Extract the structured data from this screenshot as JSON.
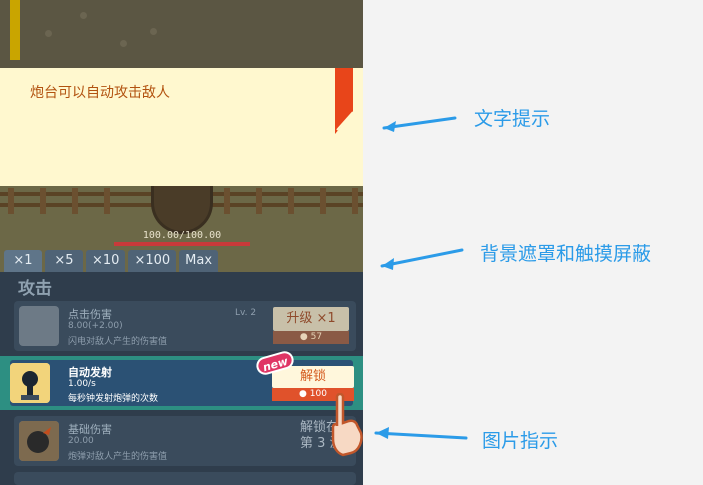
{
  "tip": {
    "text": "炮台可以自动攻击敌人"
  },
  "hp": {
    "text": "100.00/100.00",
    "fraction": 1.0
  },
  "multiplier_tabs": [
    "×1",
    "×5",
    "×10",
    "×100",
    "Max"
  ],
  "section_title": "攻击",
  "cards": [
    {
      "name": "点击伤害",
      "value": "8.00(+2.00)",
      "desc": "闪电对敌人产生的伤害值",
      "level": "Lv. 2",
      "button": "升级  ×1",
      "cost": "57",
      "icon": "lightning-hand-icon"
    },
    {
      "name": "自动发射",
      "value": "1.00/s",
      "desc": "每秒钟发射炮弹的次数",
      "badge": "new",
      "button": "解锁",
      "cost": "100",
      "icon": "cannon-icon"
    },
    {
      "name": "基础伤害",
      "value": "20.00",
      "desc": "炮弹对敌人产生的伤害值",
      "lock_line1": "解锁在",
      "lock_line2": "第 3 波",
      "icon": "cannonball-icon"
    }
  ],
  "annotations": {
    "text_hint": "文字提示",
    "mask": "背景遮罩和触摸屏蔽",
    "image_pointer": "图片指示"
  },
  "colors": {
    "annotation": "#2b9be8",
    "tip_text": "#b2520f",
    "highlight": "#2d8f82"
  }
}
